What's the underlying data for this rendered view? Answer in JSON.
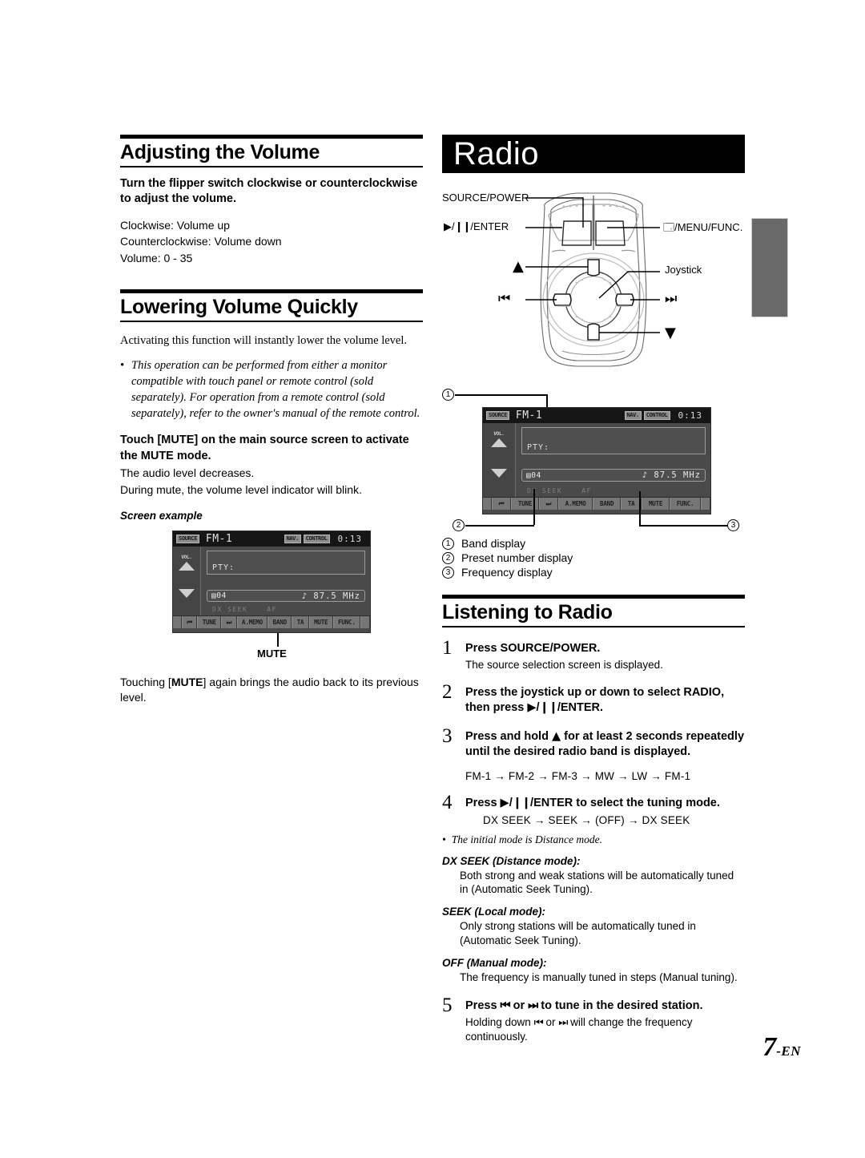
{
  "page": {
    "number": "7",
    "suffix": "-EN"
  },
  "left_column": {
    "heading1": "Adjusting the Volume",
    "instruction1": {
      "prefix": "Turn the ",
      "emphasis": "flipper switch",
      "suffix": " clockwise or counterclockwise to adjust the volume."
    },
    "details1": [
      "Clockwise: Volume up",
      "Counterclockwise: Volume down",
      "Volume: 0 - 35"
    ],
    "heading2": "Lowering Volume Quickly",
    "intro2": "Activating this function will instantly lower the volume level.",
    "bullet2": "This operation can be performed from either a monitor compatible with touch panel or remote control (sold separately). For operation from a remote control (sold separately), refer to the owner's manual of the remote control.",
    "instruction2": {
      "prefix": "Touch [",
      "emphasis": "MUTE",
      "suffix": "] on the main source screen to activate the MUTE mode."
    },
    "details2": [
      "The audio level decreases.",
      "During mute, the volume level indicator will blink."
    ],
    "screen_example_label": "Screen example",
    "mute_callout_label": "MUTE",
    "closing": {
      "prefix": "Touching [",
      "emphasis": "MUTE",
      "suffix": "] again brings the audio back to its previous level."
    }
  },
  "lcd_screen": {
    "source_chip": "SOURCE",
    "band": "FM-1",
    "nav_chip": "NAV.",
    "control_chip": "CONTROL",
    "clock": "0:13",
    "vol_label": "VOL.",
    "pty": "PTY:",
    "preset": "04",
    "frequency": "87.5 MHz",
    "status_dx": "DX SEEK",
    "status_af": "AF",
    "buttons": [
      "TUNE",
      "A.MEMO",
      "BAND",
      "TA",
      "MUTE",
      "FUNC."
    ],
    "prev_icon": "prev-track-icon",
    "next_icon": "next-track-icon"
  },
  "right_column": {
    "title": "Radio",
    "device_labels": {
      "source_power": "SOURCE/POWER",
      "play_pause_enter": "/ENTER",
      "menu_func": "/MENU/FUNC.",
      "joystick": "Joystick",
      "up": "up-triangle-icon",
      "down": "down-triangle-icon",
      "prev": "prev-track-icon",
      "next": "next-track-icon"
    },
    "callouts": [
      {
        "num": "1",
        "label": "Band display"
      },
      {
        "num": "2",
        "label": "Preset number display"
      },
      {
        "num": "3",
        "label": "Frequency display"
      }
    ],
    "heading3": "Listening to Radio",
    "steps": [
      {
        "num": "1",
        "title_prefix": "Press ",
        "title_emphasis": "SOURCE/POWER",
        "title_suffix": ".",
        "desc": "The source selection screen is displayed."
      },
      {
        "num": "2",
        "title_prefix": "Press the ",
        "title_emphasis": "joystick",
        "title_suffix": " up or down to select RADIO, then press ",
        "title_extra": "/ENTER."
      },
      {
        "num": "3",
        "title_prefix": "Press and hold ",
        "title_suffix": " for at least 2 seconds repeatedly until the desired radio band is displayed.",
        "flow": "FM-1 → FM-2 → FM-3 → MW → LW → FM-1"
      },
      {
        "num": "4",
        "title_prefix": "Press ",
        "title_emphasis": "/ENTER",
        "title_suffix": " to select the tuning mode.",
        "flow": "DX SEEK   →      SEEK      →     (OFF)     →   DX SEEK"
      },
      {
        "num": "5",
        "title_prefix": "Press ",
        "title_mid": " or ",
        "title_suffix": " to tune in the desired station.",
        "desc_prefix": "Holding down ",
        "desc_mid": " or ",
        "desc_suffix": " will change the frequency continuously."
      }
    ],
    "initial_mode_note": "The initial mode is Distance mode.",
    "modes": [
      {
        "heading": "DX SEEK (Distance mode):",
        "desc": "Both strong and weak stations will be automatically tuned in (Automatic Seek Tuning)."
      },
      {
        "heading": "SEEK (Local mode):",
        "desc": "Only strong stations will be automatically tuned in (Automatic Seek Tuning)."
      },
      {
        "heading": "OFF (Manual mode):",
        "desc": "The frequency is manually tuned in steps (Manual tuning)."
      }
    ]
  },
  "colors": {
    "title_bar_bg": "#000000",
    "lcd_bg": "#4a4a4a",
    "lcd_top_bg": "#161616",
    "lcd_button_bg": "#767676",
    "gray_tab": "#696969"
  }
}
